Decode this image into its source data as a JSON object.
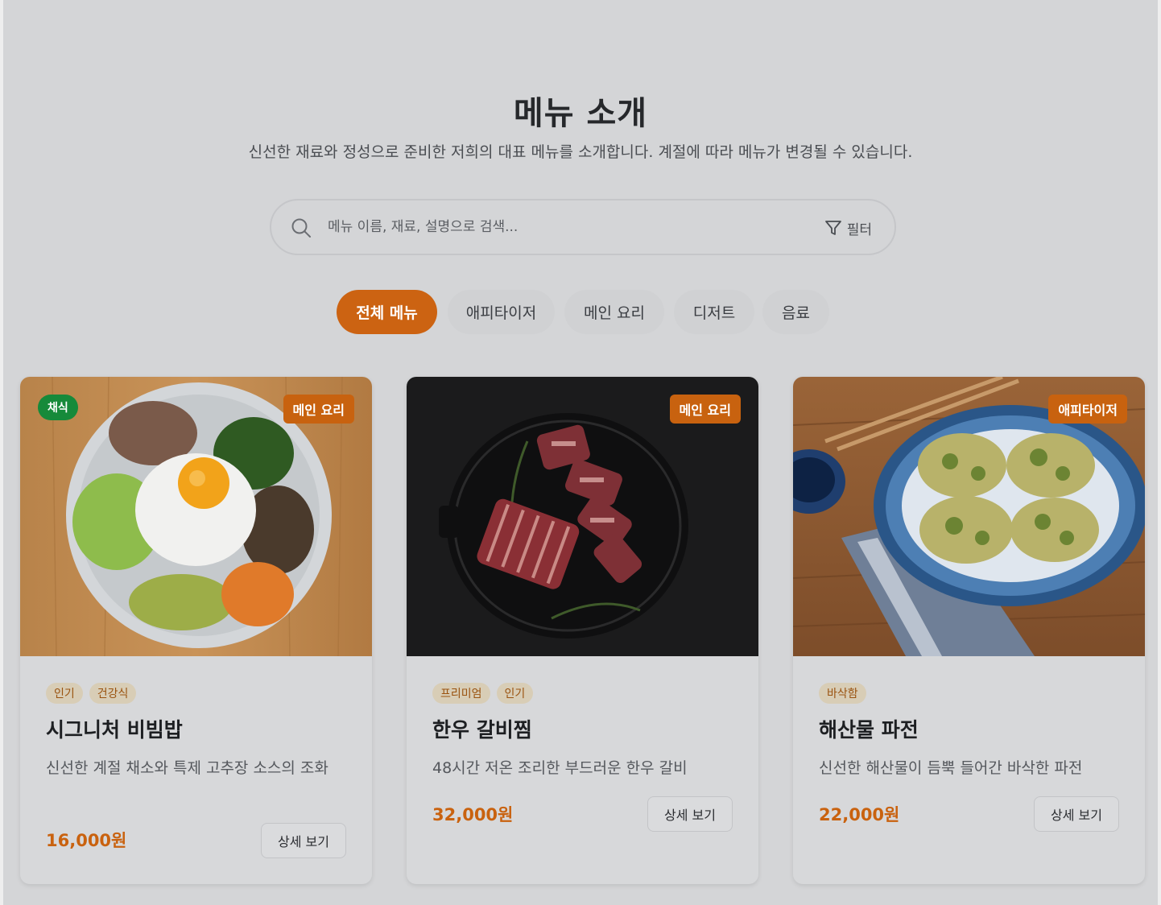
{
  "header": {
    "title": "메뉴 소개",
    "subtitle": "신선한 재료와 정성으로 준비한 저희의 대표 메뉴를 소개합니다. 계절에 따라 메뉴가 변경될 수 있습니다."
  },
  "search": {
    "placeholder": "메뉴 이름, 재료, 설명으로 검색...",
    "value": "",
    "filter_label": "필터"
  },
  "tabs": [
    {
      "label": "전체 메뉴",
      "active": true
    },
    {
      "label": "애피타이저",
      "active": false
    },
    {
      "label": "메인 요리",
      "active": false
    },
    {
      "label": "디저트",
      "active": false
    },
    {
      "label": "음료",
      "active": false
    }
  ],
  "menu_items": [
    {
      "category": "메인 요리",
      "diet_badge": "채식",
      "tags": [
        "인기",
        "건강식"
      ],
      "name": "시그니처 비빔밥",
      "description": "신선한 계절 채소와 특제 고추장 소스의 조화",
      "price": "16,000원",
      "button_label": "상세 보기"
    },
    {
      "category": "메인 요리",
      "tags": [
        "프리미엄",
        "인기"
      ],
      "name": "한우 갈비찜",
      "description": "48시간 저온 조리한 부드러운 한우 갈비",
      "price": "32,000원",
      "button_label": "상세 보기"
    },
    {
      "category": "애피타이저",
      "tags": [
        "바삭함"
      ],
      "name": "해산물 파전",
      "description": "신선한 해산물이 듬뿍 들어간 바삭한 파전",
      "price": "22,000원",
      "button_label": "상세 보기"
    }
  ],
  "colors": {
    "accent": "#cc6312",
    "veg_badge": "#168a3a",
    "background": "#d4d5d7"
  }
}
